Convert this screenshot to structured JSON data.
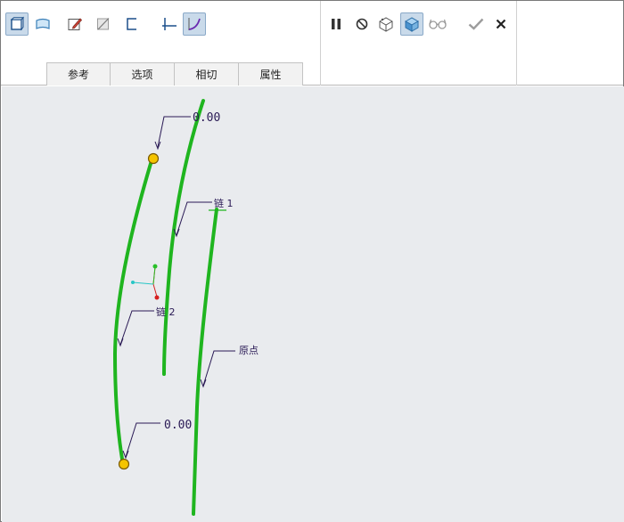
{
  "toolbar_left": [
    {
      "name": "solid-surface-button",
      "icon": "cube-icon",
      "active": true
    },
    {
      "name": "surface-button",
      "icon": "surface-icon",
      "active": false
    },
    {
      "name": "edit-sketch-button",
      "icon": "pencil-icon",
      "active": false
    },
    {
      "name": "remove-material-button",
      "icon": "slash-box-icon",
      "active": false
    },
    {
      "name": "thicken-button",
      "icon": "bracket-icon",
      "active": false
    },
    {
      "name": "straight-boundary-button",
      "icon": "straight-line-icon",
      "active": false
    },
    {
      "name": "curved-boundary-button",
      "icon": "curve-icon",
      "active": true
    }
  ],
  "toolbar_right": [
    {
      "name": "pause-button",
      "icon": "pause-icon",
      "active": false
    },
    {
      "name": "no-preview-button",
      "icon": "no-entry-icon",
      "active": false
    },
    {
      "name": "geometry-preview-button",
      "icon": "wireframe-icon",
      "active": false
    },
    {
      "name": "verify-preview-button",
      "icon": "shaded-box-icon",
      "active": true
    },
    {
      "name": "glasses-button",
      "icon": "glasses-icon",
      "active": false
    },
    {
      "name": "ok-button",
      "icon": "check-icon",
      "active": false
    },
    {
      "name": "cancel-button",
      "icon": "close-icon",
      "active": false
    }
  ],
  "tabs": [
    {
      "label": "参考"
    },
    {
      "label": "选项"
    },
    {
      "label": "相切"
    },
    {
      "label": "属性"
    }
  ],
  "canvas": {
    "dim_top": "0.00",
    "dim_bottom": "0.00",
    "chain1_label": "链 1",
    "chain2_label": "链 2",
    "origin_label": "原点"
  },
  "colors": {
    "curve": "#1fb51f",
    "leader": "#2a1a55",
    "handle": "#f5c400",
    "background": "#e9ebee"
  }
}
